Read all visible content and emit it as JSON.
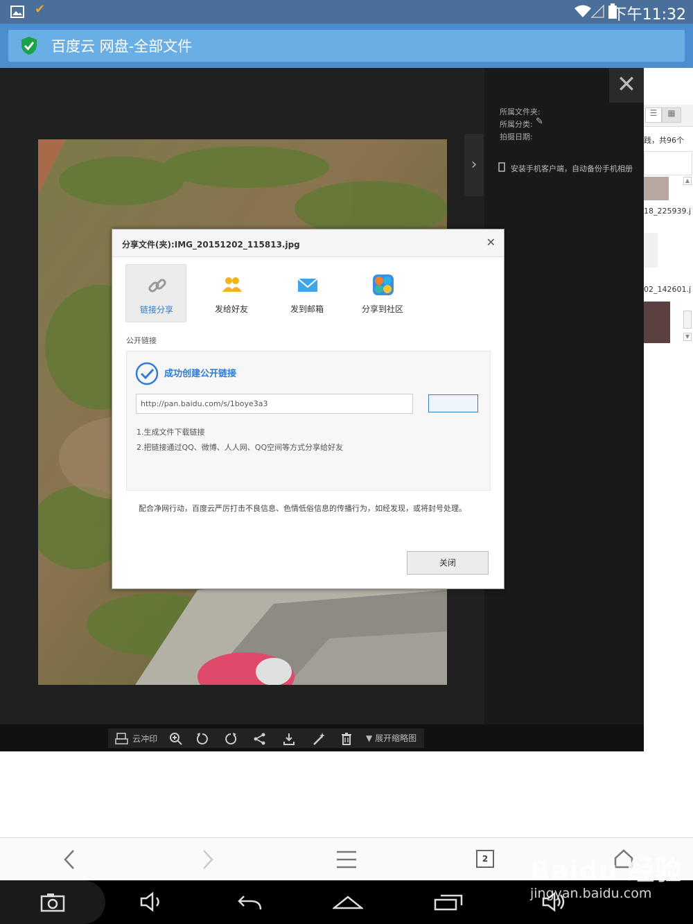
{
  "statusbar": {
    "time": "下午11:32"
  },
  "browser": {
    "title": "百度云 网盘-全部文件"
  },
  "info": {
    "folder_label": "所属文件夹:",
    "category_label": "所属分类:",
    "date_label": "拍摄日期:",
    "install_tip": "安装手机客户端，自动备份手机相册"
  },
  "sliver": {
    "count": "践，共96个",
    "file1": "18_225939.j",
    "file2": "02_142601.j"
  },
  "toolbar": {
    "print_label": "云冲印",
    "expand_label": "展开缩略图"
  },
  "dialog": {
    "title": "分享文件(夹):IMG_20151202_115813.jpg",
    "tabs": [
      {
        "label": "链接分享"
      },
      {
        "label": "发给好友"
      },
      {
        "label": "发到邮箱"
      },
      {
        "label": "分享到社区"
      }
    ],
    "section_label": "公开链接",
    "success_text": "成功创建公开链接",
    "link_url": "http://pan.baidu.com/s/1boye3a3",
    "tip1": "1.生成文件下载链接",
    "tip2": "2.把链接通过QQ、微博、人人网、QQ空间等方式分享给好友",
    "notice": "配合净网行动，百度云严厉打击不良信息、色情低俗信息的传播行为，如经发现，或将封号处理。",
    "close_label": "关闭"
  },
  "browsernav": {
    "tab_count": "2"
  },
  "watermark": {
    "brand": "Baidu 经验",
    "url": "jingyan.baidu.com"
  },
  "colors": {
    "accent": "#2d7bd6",
    "titlebar": "#4a8ed0",
    "viewer_bg": "#202020"
  }
}
